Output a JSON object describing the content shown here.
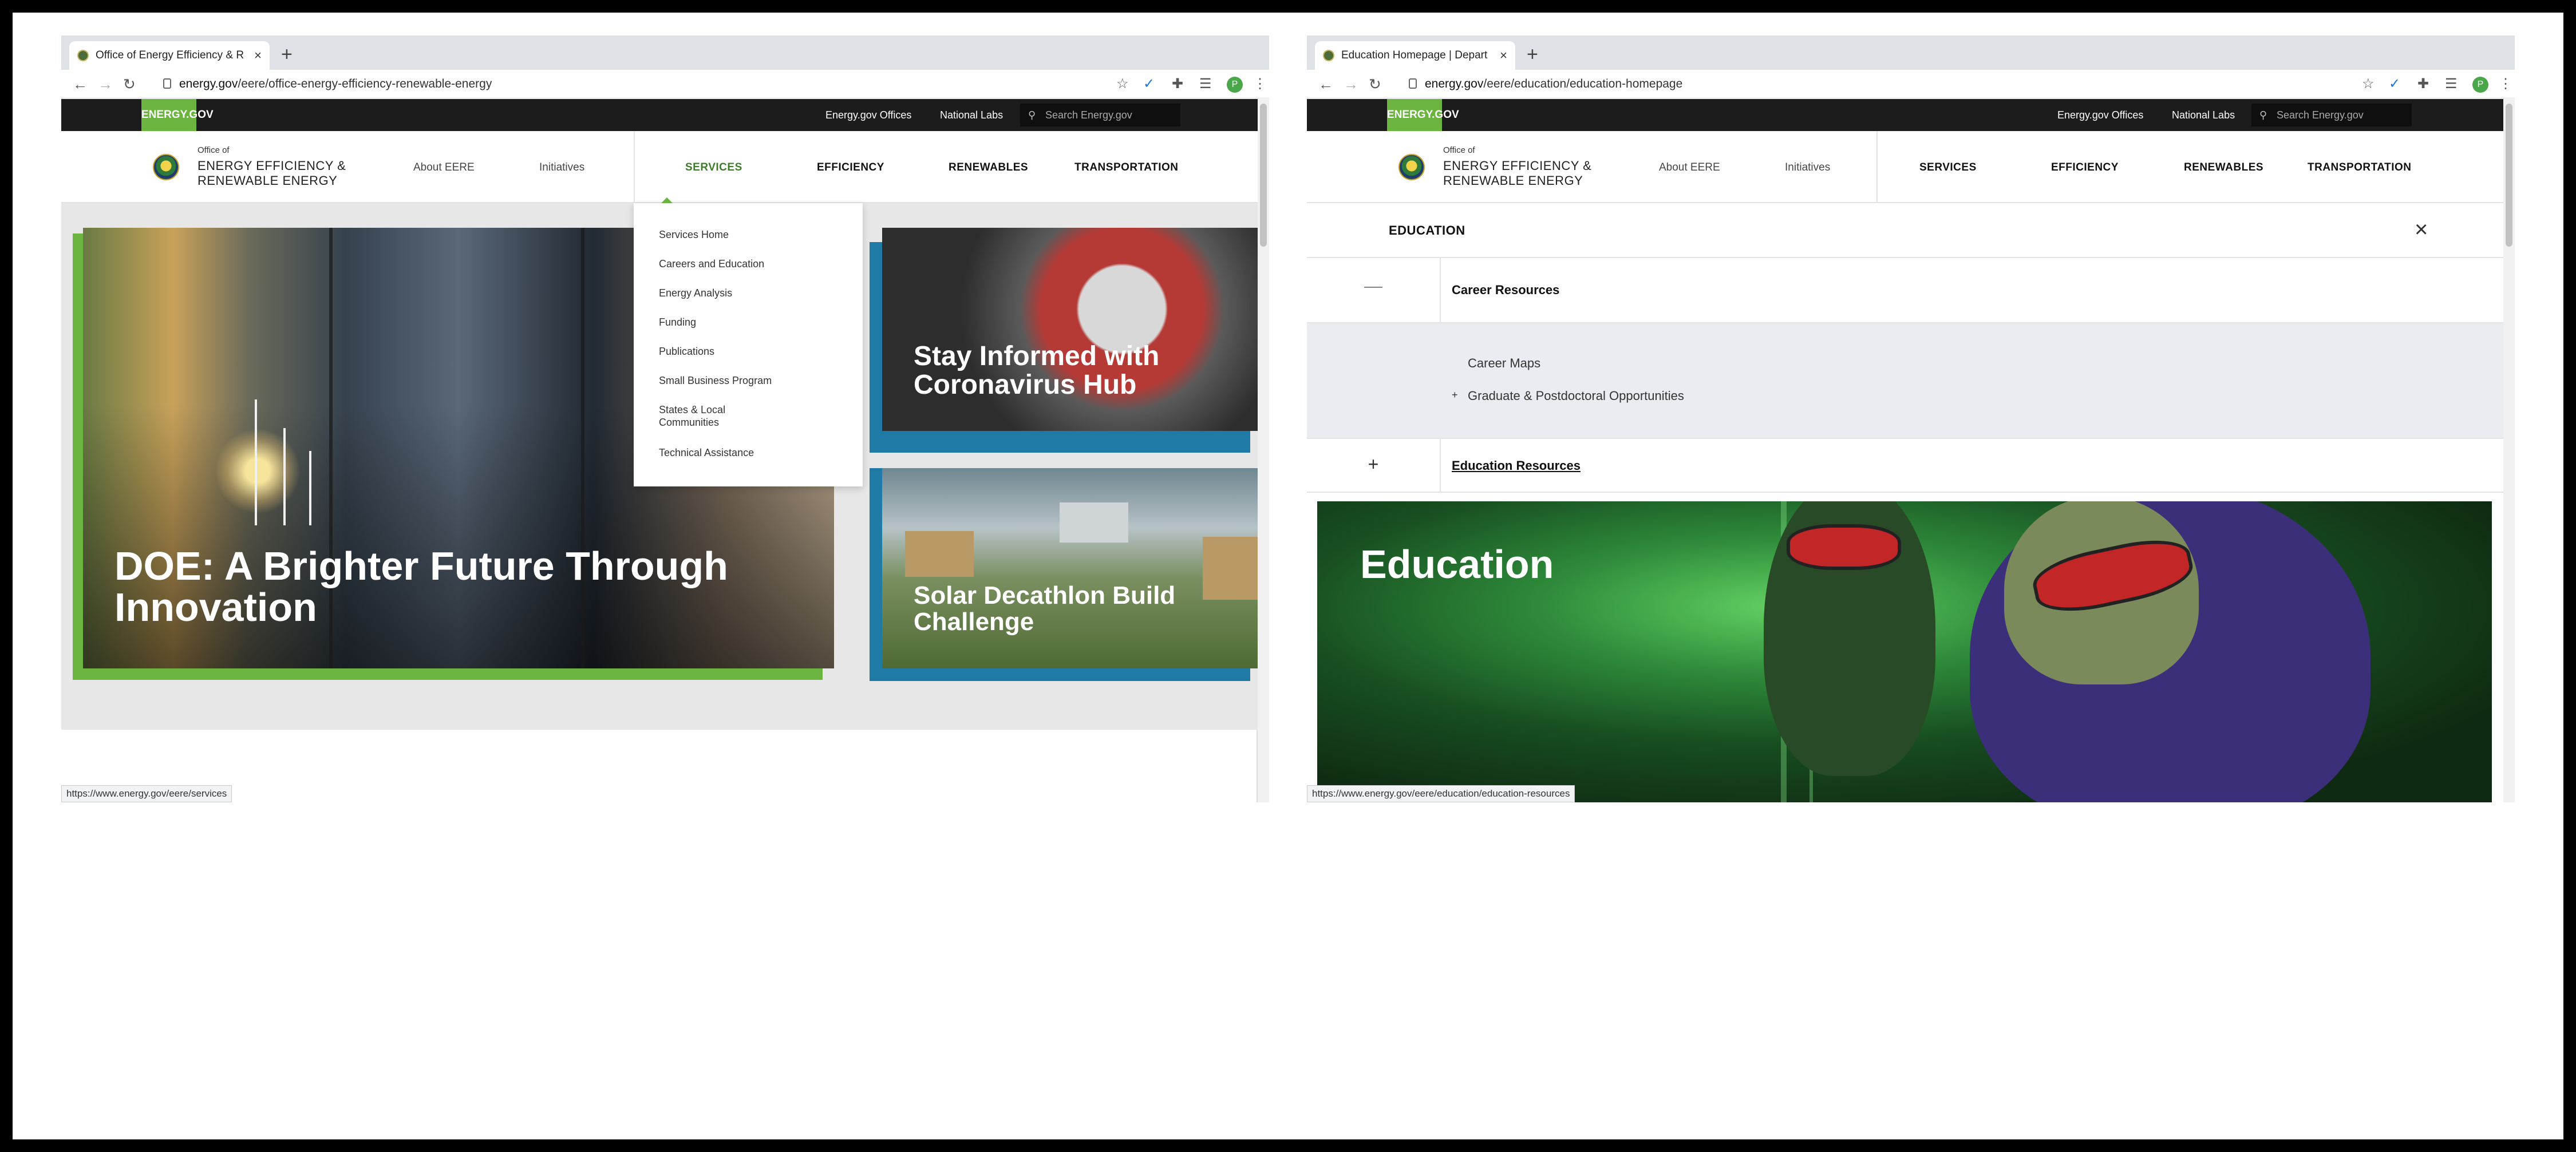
{
  "left": {
    "tab_title": "Office of Energy Efficiency & R",
    "url_host": "energy.gov",
    "url_path": "/eere/office-energy-efficiency-renewable-energy",
    "brand": "ENERGY.GOV",
    "util_links": [
      "Energy.gov Offices",
      "National Labs"
    ],
    "search_placeholder": "Search Energy.gov",
    "logo_small": "Office of",
    "logo_line1": "ENERGY EFFICIENCY &",
    "logo_line2": "RENEWABLE ENERGY",
    "nav": [
      "About EERE",
      "Initiatives",
      "SERVICES",
      "EFFICIENCY",
      "RENEWABLES",
      "TRANSPORTATION"
    ],
    "dropdown": [
      "Services Home",
      "Careers and Education",
      "Energy Analysis",
      "Funding",
      "Publications",
      "Small Business Program",
      "States & Local Communities",
      "Technical Assistance"
    ],
    "hero_title": "DOE: A Brighter Future Through Innovation",
    "card1_title": "Stay Informed with Coronavirus Hub",
    "card2_title": "Solar Decathlon Build Challenge",
    "status_url": "https://www.energy.gov/eere/services"
  },
  "right": {
    "tab_title": "Education Homepage | Depart",
    "url_host": "energy.gov",
    "url_path": "/eere/education/education-homepage",
    "brand": "ENERGY.GOV",
    "util_links": [
      "Energy.gov Offices",
      "National Labs"
    ],
    "search_placeholder": "Search Energy.gov",
    "logo_small": "Office of",
    "logo_line1": "ENERGY EFFICIENCY &",
    "logo_line2": "RENEWABLE ENERGY",
    "nav": [
      "About EERE",
      "Initiatives",
      "SERVICES",
      "EFFICIENCY",
      "RENEWABLES",
      "TRANSPORTATION"
    ],
    "section_label": "EDUCATION",
    "accordion1_symbol": "—",
    "accordion1_label": "Career Resources",
    "sub_links": [
      "Career Maps",
      "Graduate & Postdoctoral Opportunities"
    ],
    "sub_link_plus": "+",
    "accordion2_symbol": "+",
    "accordion2_label": "Education Resources",
    "hero_title": "Education",
    "status_url": "https://www.energy.gov/eere/education/education-resources"
  },
  "browser": {
    "close_glyph": "×",
    "new_tab_glyph": "+",
    "back_glyph": "←",
    "forward_glyph": "→",
    "reload_glyph": "↻",
    "star_glyph": "☆",
    "ext_glyph": "✚",
    "menu_glyph": "⋮",
    "profile_initial": "P"
  },
  "colors": {
    "brand_green": "#6bb43f",
    "accent_blue": "#1f7ba6",
    "util_bar": "#1c1c1c"
  }
}
